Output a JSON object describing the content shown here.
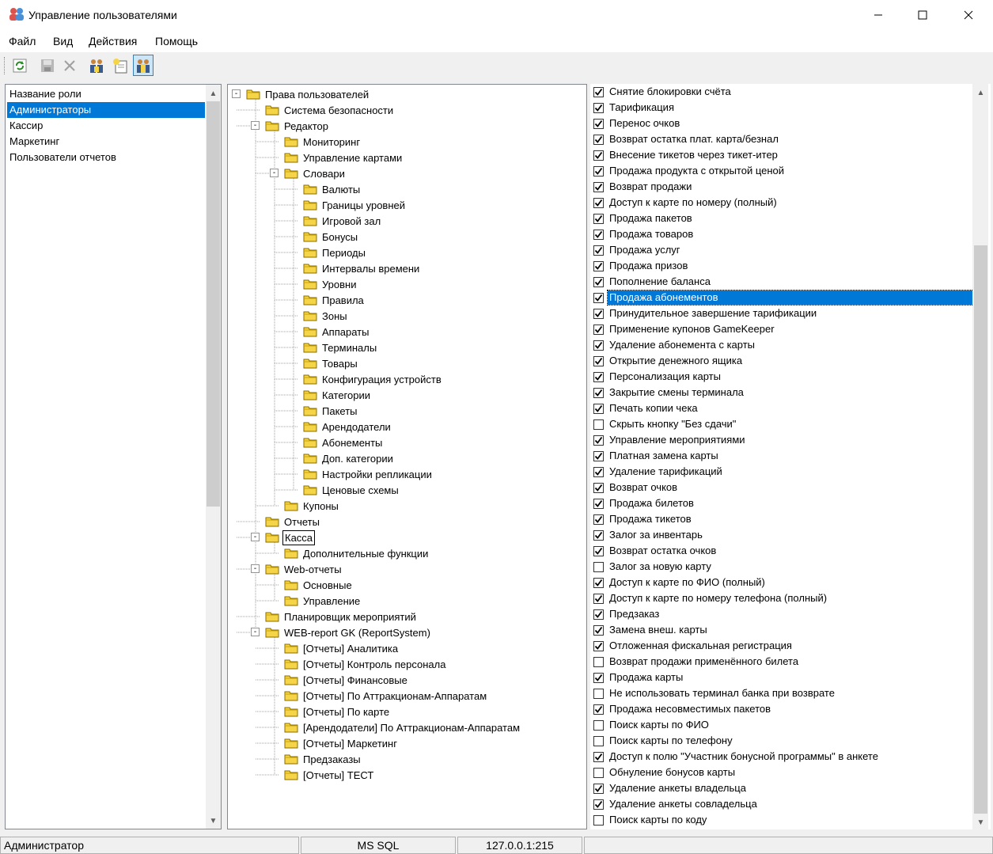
{
  "window": {
    "title": "Управление пользователями"
  },
  "menu": [
    "Файл",
    "Вид",
    "Действия",
    "Помощь"
  ],
  "toolbar": {
    "icons": [
      "refresh-icon",
      "save-icon",
      "delete-icon",
      "users-icon",
      "new-user-icon",
      "user-rights-icon"
    ]
  },
  "roles": {
    "header": "Название роли",
    "items": [
      "Администраторы",
      "Кассир",
      "Маркетинг",
      "Пользователи отчетов"
    ],
    "selected_index": 0
  },
  "tree": {
    "nodes": [
      {
        "label": "Права пользователей",
        "level": 0,
        "toggle": "-"
      },
      {
        "label": "Система безопасности",
        "level": 1,
        "toggle": ""
      },
      {
        "label": "Редактор",
        "level": 1,
        "toggle": "-"
      },
      {
        "label": "Мониторинг",
        "level": 2,
        "toggle": ""
      },
      {
        "label": "Управление картами",
        "level": 2,
        "toggle": ""
      },
      {
        "label": "Словари",
        "level": 2,
        "toggle": "-"
      },
      {
        "label": "Валюты",
        "level": 3,
        "toggle": ""
      },
      {
        "label": "Границы уровней",
        "level": 3,
        "toggle": ""
      },
      {
        "label": "Игровой зал",
        "level": 3,
        "toggle": ""
      },
      {
        "label": "Бонусы",
        "level": 3,
        "toggle": ""
      },
      {
        "label": "Периоды",
        "level": 3,
        "toggle": ""
      },
      {
        "label": "Интервалы времени",
        "level": 3,
        "toggle": ""
      },
      {
        "label": "Уровни",
        "level": 3,
        "toggle": ""
      },
      {
        "label": "Правила",
        "level": 3,
        "toggle": ""
      },
      {
        "label": "Зоны",
        "level": 3,
        "toggle": ""
      },
      {
        "label": "Аппараты",
        "level": 3,
        "toggle": ""
      },
      {
        "label": "Терминалы",
        "level": 3,
        "toggle": ""
      },
      {
        "label": "Товары",
        "level": 3,
        "toggle": ""
      },
      {
        "label": "Конфигурация устройств",
        "level": 3,
        "toggle": ""
      },
      {
        "label": "Категории",
        "level": 3,
        "toggle": ""
      },
      {
        "label": "Пакеты",
        "level": 3,
        "toggle": ""
      },
      {
        "label": "Арендодатели",
        "level": 3,
        "toggle": ""
      },
      {
        "label": "Абонементы",
        "level": 3,
        "toggle": ""
      },
      {
        "label": "Доп. категории",
        "level": 3,
        "toggle": ""
      },
      {
        "label": "Настройки репликации",
        "level": 3,
        "toggle": ""
      },
      {
        "label": "Ценовые схемы",
        "level": 3,
        "toggle": ""
      },
      {
        "label": "Купоны",
        "level": 2,
        "toggle": ""
      },
      {
        "label": "Отчеты",
        "level": 1,
        "toggle": ""
      },
      {
        "label": "Касса",
        "level": 1,
        "toggle": "-",
        "focused": true
      },
      {
        "label": "Дополнительные функции",
        "level": 2,
        "toggle": ""
      },
      {
        "label": "Web-отчеты",
        "level": 1,
        "toggle": "-"
      },
      {
        "label": "Основные",
        "level": 2,
        "toggle": ""
      },
      {
        "label": "Управление",
        "level": 2,
        "toggle": ""
      },
      {
        "label": "Планировщик мероприятий",
        "level": 1,
        "toggle": ""
      },
      {
        "label": "WEB-report GK (ReportSystem)",
        "level": 1,
        "toggle": "-"
      },
      {
        "label": "[Отчеты] Аналитика",
        "level": 2,
        "toggle": ""
      },
      {
        "label": "[Отчеты] Контроль персонала",
        "level": 2,
        "toggle": ""
      },
      {
        "label": "[Отчеты] Финансовые",
        "level": 2,
        "toggle": ""
      },
      {
        "label": "[Отчеты]  По Аттракционам-Аппаратам",
        "level": 2,
        "toggle": ""
      },
      {
        "label": "[Отчеты] По карте",
        "level": 2,
        "toggle": ""
      },
      {
        "label": "[Арендодатели] По Аттракционам-Аппаратам",
        "level": 2,
        "toggle": ""
      },
      {
        "label": "[Отчеты] Маркетинг",
        "level": 2,
        "toggle": ""
      },
      {
        "label": "Предзаказы",
        "level": 2,
        "toggle": ""
      },
      {
        "label": "[Отчеты] ТЕСТ",
        "level": 2,
        "toggle": ""
      }
    ]
  },
  "permissions": {
    "selected_index": 13,
    "items": [
      {
        "label": "Снятие блокировки счёта",
        "checked": true
      },
      {
        "label": "Тарификация",
        "checked": true
      },
      {
        "label": "Перенос очков",
        "checked": true
      },
      {
        "label": "Возврат остатка плат. карта/безнал",
        "checked": true
      },
      {
        "label": "Внесение тикетов через тикет-итер",
        "checked": true
      },
      {
        "label": "Продажа продукта с открытой ценой",
        "checked": true
      },
      {
        "label": "Возврат продажи",
        "checked": true
      },
      {
        "label": "Доступ к карте по номеру (полный)",
        "checked": true
      },
      {
        "label": "Продажа пакетов",
        "checked": true
      },
      {
        "label": "Продажа товаров",
        "checked": true
      },
      {
        "label": "Продажа услуг",
        "checked": true
      },
      {
        "label": "Продажа призов",
        "checked": true
      },
      {
        "label": "Пополнение баланса",
        "checked": true
      },
      {
        "label": "Продажа абонементов",
        "checked": true
      },
      {
        "label": "Принудительное завершение тарификации",
        "checked": true
      },
      {
        "label": "Применение купонов GameKeeper",
        "checked": true
      },
      {
        "label": "Удаление абонемента с карты",
        "checked": true
      },
      {
        "label": "Открытие денежного ящика",
        "checked": true
      },
      {
        "label": "Персонализация карты",
        "checked": true
      },
      {
        "label": "Закрытие смены терминала",
        "checked": true
      },
      {
        "label": "Печать копии чека",
        "checked": true
      },
      {
        "label": "Скрыть кнопку \"Без сдачи\"",
        "checked": false
      },
      {
        "label": "Управление мероприятиями",
        "checked": true
      },
      {
        "label": "Платная замена карты",
        "checked": true
      },
      {
        "label": "Удаление тарификаций",
        "checked": true
      },
      {
        "label": "Возврат очков",
        "checked": true
      },
      {
        "label": "Продажа билетов",
        "checked": true
      },
      {
        "label": "Продажа тикетов",
        "checked": true
      },
      {
        "label": "Залог за инвентарь",
        "checked": true
      },
      {
        "label": "Возврат остатка очков",
        "checked": true
      },
      {
        "label": "Залог за новую карту",
        "checked": false
      },
      {
        "label": "Доступ к карте по ФИО (полный)",
        "checked": true
      },
      {
        "label": "Доступ к карте по номеру телефона (полный)",
        "checked": true
      },
      {
        "label": "Предзаказ",
        "checked": true
      },
      {
        "label": "Замена внеш. карты",
        "checked": true
      },
      {
        "label": "Отложенная фискальная регистрация",
        "checked": true
      },
      {
        "label": "Возврат продажи применённого билета",
        "checked": false
      },
      {
        "label": "Продажа карты",
        "checked": true
      },
      {
        "label": "Не использовать терминал банка при возврате",
        "checked": false
      },
      {
        "label": "Продажа несовместимых пакетов",
        "checked": true
      },
      {
        "label": "Поиск карты по ФИО",
        "checked": false
      },
      {
        "label": "Поиск карты по телефону",
        "checked": false
      },
      {
        "label": "Доступ к полю \"Участник бонусной программы\" в анкете",
        "checked": true
      },
      {
        "label": "Обнуление бонусов карты",
        "checked": false
      },
      {
        "label": "Удаление анкеты владельца",
        "checked": true
      },
      {
        "label": "Удаление анкеты совладельца",
        "checked": true
      },
      {
        "label": "Поиск карты по коду",
        "checked": false
      }
    ]
  },
  "status": {
    "user": "Администратор",
    "db": "MS SQL",
    "server": "127.0.0.1:215"
  },
  "colors": {
    "selection": "#0078d7",
    "folder": "#f5d547"
  }
}
